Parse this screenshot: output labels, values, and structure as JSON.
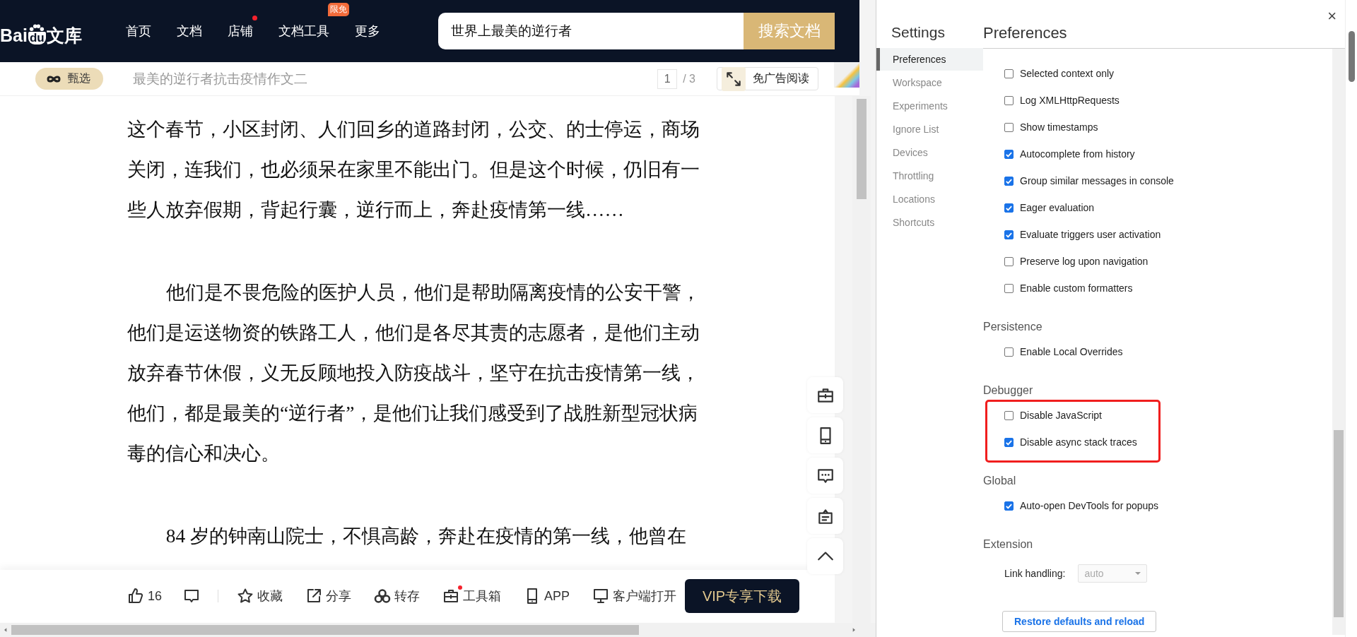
{
  "site_header": {
    "logo": {
      "text_left": "Bai",
      "paw_text": "du",
      "text_right": "文库"
    },
    "nav": [
      {
        "label": "首页",
        "dot": false
      },
      {
        "label": "文档",
        "dot": false
      },
      {
        "label": "店铺",
        "dot": true
      },
      {
        "label": "文档工具",
        "dot": false,
        "badge": "限免"
      },
      {
        "label": "更多",
        "dot": false
      }
    ],
    "search": {
      "value": "世界上最美的逆行者",
      "button": "搜索文档"
    }
  },
  "doc_bar": {
    "badge": "甄选",
    "title": "最美的逆行者抗击疫情作文二",
    "page_current": "1",
    "page_total": "/ 3",
    "ad_free_button": "免广告阅读"
  },
  "article": {
    "paragraphs": [
      {
        "indent": false,
        "text": "这个春节，小区封闭、人们回乡的道路封闭，公交、的士停运，商场关闭，连我们，也必须呆在家里不能出门。但是这个时候，仍旧有一些人放弃假期，背起行囊，逆行而上，奔赴疫情第一线……"
      },
      {
        "indent": true,
        "text": "他们是不畏危险的医护人员，他们是帮助隔离疫情的公安干警，他们是运送物资的铁路工人，他们是各尽其责的志愿者，是他们主动放弃春节休假，义无反顾地投入防疫战斗，坚守在抗击疫情第一线，他们，都是最美的“逆行者”，是他们让我们感受到了战胜新型冠状病毒的信心和决心。"
      },
      {
        "indent": true,
        "text": "84 岁的钟南山院士，不惧高龄，奔赴在疫情的第一线，他曾在"
      }
    ]
  },
  "bottom_bar": {
    "like_count": "16",
    "actions": [
      {
        "kind": "star",
        "label": "收藏",
        "dot": false
      },
      {
        "kind": "share",
        "label": "分享",
        "dot": false
      },
      {
        "kind": "cloud",
        "label": "转存",
        "dot": false
      },
      {
        "kind": "toolbox",
        "label": "工具箱",
        "dot": true
      },
      {
        "kind": "phone",
        "label": "APP",
        "dot": false
      },
      {
        "kind": "monitor",
        "label": "客户端打开",
        "dot": false
      }
    ],
    "vip_button": "VIP专享下载"
  },
  "settings": {
    "close_button": "×",
    "title": "Settings",
    "nav": [
      {
        "label": "Preferences",
        "selected": true
      },
      {
        "label": "Workspace",
        "selected": false
      },
      {
        "label": "Experiments",
        "selected": false
      },
      {
        "label": "Ignore List",
        "selected": false
      },
      {
        "label": "Devices",
        "selected": false
      },
      {
        "label": "Throttling",
        "selected": false
      },
      {
        "label": "Locations",
        "selected": false
      },
      {
        "label": "Shortcuts",
        "selected": false
      }
    ],
    "heading": "Preferences",
    "sections": [
      {
        "highlighted": false,
        "options": [
          {
            "label": "Selected context only",
            "checked": false
          },
          {
            "label": "Log XMLHttpRequests",
            "checked": false
          },
          {
            "label": "Show timestamps",
            "checked": false
          },
          {
            "label": "Autocomplete from history",
            "checked": true
          },
          {
            "label": "Group similar messages in console",
            "checked": true
          },
          {
            "label": "Eager evaluation",
            "checked": true
          },
          {
            "label": "Evaluate triggers user activation",
            "checked": true
          },
          {
            "label": "Preserve log upon navigation",
            "checked": false
          },
          {
            "label": "Enable custom formatters",
            "checked": false
          }
        ]
      },
      {
        "title": "Persistence",
        "highlighted": false,
        "options": [
          {
            "label": "Enable Local Overrides",
            "checked": false
          }
        ]
      },
      {
        "title": "Debugger",
        "highlighted": true,
        "options": [
          {
            "label": "Disable JavaScript",
            "checked": false
          },
          {
            "label": "Disable async stack traces",
            "checked": true
          }
        ]
      },
      {
        "title": "Global",
        "highlighted": false,
        "options": [
          {
            "label": "Auto-open DevTools for popups",
            "checked": true
          }
        ]
      },
      {
        "title": "Extension",
        "highlighted": false,
        "select": {
          "label": "Link handling:",
          "value": "auto",
          "disabled": true
        }
      }
    ],
    "restore_button": "Restore defaults and reload"
  }
}
